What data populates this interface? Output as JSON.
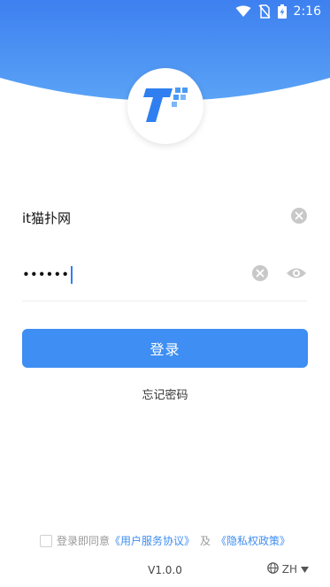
{
  "status_bar": {
    "time": "2:16",
    "icons": [
      "wifi-icon",
      "no-sim-icon",
      "battery-charging-icon"
    ]
  },
  "brand": {
    "logo_icon": "t-logo-icon",
    "accent_color": "#3e8ef3",
    "header_color": "#3d86f2"
  },
  "form": {
    "username_value": "it猫扑网",
    "password_mask": "••••••",
    "clear_icon": "clear-circle-icon",
    "visibility_icon": "eye-icon",
    "login_label": "登录",
    "forgot_label": "忘记密码"
  },
  "agreement": {
    "prefix": "登录即同意",
    "user_agreement": "《用户服务协议》",
    "and": "及",
    "privacy_policy": "《隐私权政策》"
  },
  "footer": {
    "version": "V1.0.0",
    "language": "ZH",
    "globe_icon": "globe-icon",
    "dropdown_icon": "caret-down-icon"
  }
}
